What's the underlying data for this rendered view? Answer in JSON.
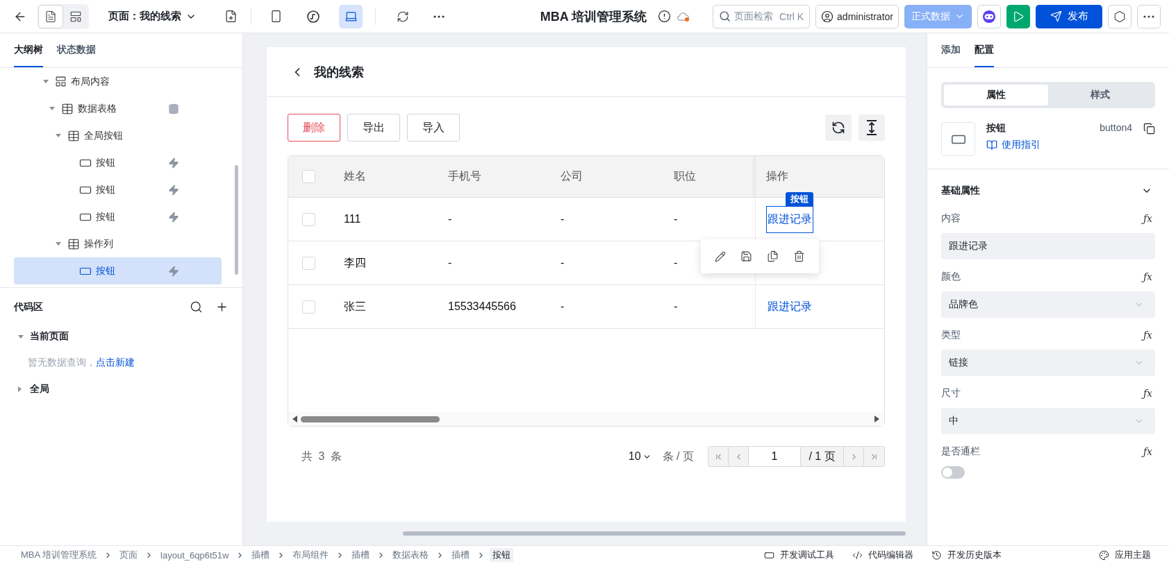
{
  "topbar": {
    "view_modes": [
      {
        "kind": "outline",
        "selected": true
      },
      {
        "kind": "layout",
        "selected": false
      }
    ],
    "page_label": "页面：我的线索",
    "devices": [
      {
        "kind": "mobile",
        "selected": false
      },
      {
        "kind": "miniapp",
        "selected": false
      },
      {
        "kind": "desktop",
        "selected": true
      }
    ],
    "title": "MBA 培训管理系统",
    "search": {
      "placeholder": "页面检索",
      "shortcut": "Ctrl K"
    },
    "user": "administrator",
    "env": "正式数据",
    "publish": "发布"
  },
  "left": {
    "tabs": [
      {
        "label": "大纲树",
        "selected": true
      },
      {
        "label": "状态数据",
        "selected": false
      }
    ],
    "tree": [
      {
        "label": "布局内容",
        "kind": "layout",
        "expanded": true,
        "selected": false,
        "children": [
          {
            "label": "数据表格",
            "kind": "data-table",
            "expanded": true,
            "selected": false,
            "children": [
              {
                "label": "全局按钮",
                "kind": "group",
                "expanded": true,
                "selected": false,
                "children": [
                  {
                    "label": "按钮",
                    "kind": "button",
                    "selected": false
                  },
                  {
                    "label": "按钮",
                    "kind": "button",
                    "selected": false
                  },
                  {
                    "label": "按钮",
                    "kind": "button",
                    "selected": false
                  }
                ]
              },
              {
                "label": "操作列",
                "kind": "group",
                "expanded": true,
                "selected": false,
                "children": [
                  {
                    "label": "按钮",
                    "kind": "button",
                    "selected": true
                  }
                ]
              }
            ]
          }
        ]
      }
    ],
    "code_area": {
      "title": "代码区",
      "sections": [
        {
          "label": "当前页面",
          "expanded": true,
          "empty_text": "暂无数据查询，",
          "link": "点击新建"
        },
        {
          "label": "全局",
          "expanded": false
        }
      ]
    }
  },
  "canvas": {
    "title": "我的线索",
    "buttons": [
      {
        "label": "删除",
        "kind": "danger"
      },
      {
        "label": "导出",
        "kind": "default"
      },
      {
        "label": "导入",
        "kind": "default"
      }
    ],
    "table": {
      "header_checked": false,
      "columns": [
        "姓名",
        "手机号",
        "公司",
        "职位",
        "操作"
      ],
      "rows": [
        {
          "checked": false,
          "cells": [
            "111",
            "-",
            "-",
            "-"
          ],
          "action": "跟进记录",
          "selected": true
        },
        {
          "checked": false,
          "cells": [
            "李四",
            "-",
            "-",
            "-"
          ],
          "selected": false
        },
        {
          "checked": false,
          "cells": [
            "张三",
            "15533445566",
            "-",
            "-"
          ],
          "action": "跟进记录",
          "selected": false
        }
      ],
      "selection_badge": "按钮"
    },
    "pagination": {
      "total": "共 3 条",
      "page_size": "10",
      "per_page": "条 / 页",
      "page": "1",
      "pages": "/ 1 页"
    }
  },
  "right": {
    "tabs": [
      {
        "label": "添加",
        "selected": false
      },
      {
        "label": "配置",
        "selected": true
      }
    ],
    "segments": [
      {
        "label": "属性",
        "selected": true
      },
      {
        "label": "样式",
        "selected": false
      }
    ],
    "component": {
      "name": "按钮",
      "guide": "使用指引",
      "id": "button4"
    },
    "section": {
      "title": "基础属性",
      "expanded": true
    },
    "fields": [
      {
        "label": "内容",
        "kind": "text",
        "value": "跟进记录",
        "formula": "ƒx"
      },
      {
        "label": "颜色",
        "kind": "select",
        "value": "品牌色",
        "formula": "ƒx"
      },
      {
        "label": "类型",
        "kind": "select",
        "value": "链接",
        "formula": "ƒx"
      },
      {
        "label": "尺寸",
        "kind": "select",
        "value": "中",
        "formula": "ƒx"
      },
      {
        "label": "是否通栏",
        "kind": "switch",
        "on": false,
        "formula": "ƒx"
      }
    ]
  },
  "bottom": {
    "breadcrumb": [
      "MBA 培训管理系统",
      "页面",
      "layout_6qp6t51w",
      "插槽",
      "布局组件",
      "插槽",
      "数据表格",
      "插槽",
      "按钮"
    ],
    "tools": [
      {
        "label": "开发调试工具",
        "kind": "debug"
      },
      {
        "label": "代码编辑器",
        "kind": "code"
      },
      {
        "label": "开发历史版本",
        "kind": "history"
      }
    ],
    "theme": "应用主题"
  }
}
